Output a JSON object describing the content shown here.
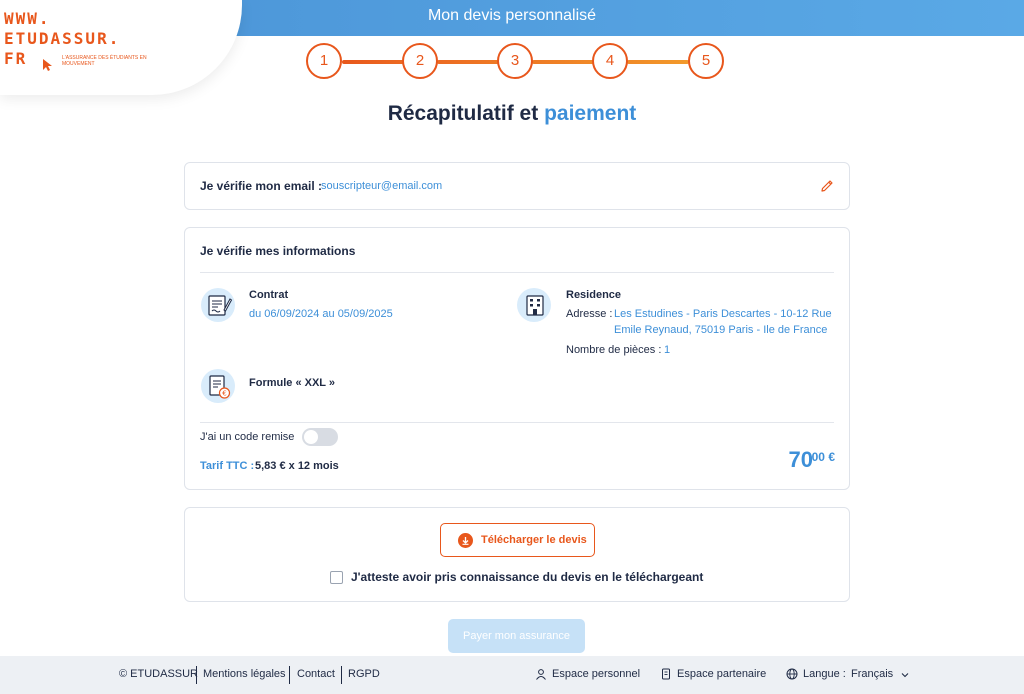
{
  "header": {
    "title": "Mon devis personnalisé"
  },
  "logo": {
    "line1": "WWW.",
    "line2": "ETUDASSUR.",
    "line3": "FR",
    "tagline": "L'ASSURANCE DES ÉTUDIANTS EN MOUVEMENT"
  },
  "stepper": {
    "steps": [
      "1",
      "2",
      "3",
      "4",
      "5"
    ],
    "current_step": 5
  },
  "page": {
    "title_main": "Récapitulatif et ",
    "title_accent": "paiement"
  },
  "email_card": {
    "label": "Je vérifie mon email :",
    "value": "souscripteur@email.com",
    "edit_icon": "pencil-icon"
  },
  "info_card": {
    "title": "Je vérifie mes informations",
    "contract": {
      "icon": "contract-icon",
      "label": "Contrat",
      "dates": "du 06/09/2024 au 05/09/2025"
    },
    "residence": {
      "icon": "building-icon",
      "label": "Residence",
      "address_label": "Adresse :",
      "address_line1": "Les Estudines - Paris Descartes - 10-12 Rue",
      "address_line2": "Emile Reynaud, 75019 Paris - Ile de France",
      "rooms_label": "Nombre de pièces :",
      "rooms_value": "1"
    },
    "formula": {
      "icon": "invoice-euro-icon",
      "label": "Formule « XXL »"
    },
    "promo": {
      "label": "J'ai un code remise",
      "enabled": false
    },
    "tarif": {
      "label": "Tarif TTC :",
      "value": "5,83 € x 12 mois"
    },
    "price": {
      "integer": "70",
      "decimal": ",00 €"
    }
  },
  "download_card": {
    "button_label": "Télécharger le devis",
    "button_icon": "download-icon",
    "attest_label": "J'atteste avoir pris connaissance du devis en le téléchargeant",
    "attest_checked": false
  },
  "pay_button": {
    "label": "Payer mon assurance",
    "disabled": true
  },
  "footer": {
    "copyright": "© ETUDASSUR",
    "links": [
      "Mentions légales",
      "Contact",
      "RGPD"
    ],
    "espace_personnel": "Espace personnel",
    "espace_partenaire": "Espace partenaire",
    "langue_label": "Langue :",
    "langue_value": "Français"
  },
  "colors": {
    "accent_orange": "#e8571c",
    "accent_blue": "#3d8fd8",
    "header_blue": "#5aa9e6",
    "text_dark": "#1f2a44"
  }
}
